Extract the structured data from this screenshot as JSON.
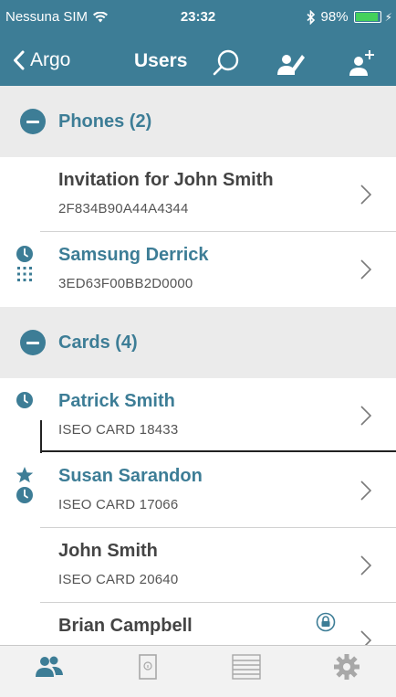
{
  "status_bar": {
    "carrier": "Nessuna SIM",
    "time": "23:32",
    "battery_percent": "98%",
    "battery_level": 0.98,
    "icons": [
      "wifi-icon",
      "bluetooth-icon",
      "battery-icon"
    ]
  },
  "nav": {
    "back_label": "Argo",
    "title": "Users",
    "icons": [
      "search-icon",
      "edit-user-icon",
      "add-user-icon"
    ]
  },
  "sections": [
    {
      "title": "Phones (2)",
      "rows": [
        {
          "name": "Invitation for John Smith",
          "sub": "2F834B90A44A4344"
        },
        {
          "name": "Samsung Derrick",
          "sub": "3ED63F00BB2D0000",
          "icons": [
            "clock-icon",
            "keypad-icon"
          ]
        }
      ]
    },
    {
      "title": "Cards (4)",
      "rows": [
        {
          "name": "Patrick Smith",
          "sub": "ISEO CARD 18433",
          "icons": [
            "clock-icon"
          ]
        },
        {
          "name": "Susan Sarandon",
          "sub": "ISEO CARD 17066",
          "icons": [
            "star-icon",
            "clock-icon"
          ]
        },
        {
          "name": "John Smith",
          "sub": "ISEO CARD 20640"
        },
        {
          "name": "Brian Campbell",
          "sub": "",
          "icons": [
            "lock-icon"
          ]
        }
      ]
    }
  ],
  "tab_bar": {
    "tabs": [
      {
        "icon": "users-icon",
        "label": ""
      },
      {
        "icon": "door-icon",
        "label": ""
      },
      {
        "icon": "list-icon",
        "label": ""
      },
      {
        "icon": "gear-icon",
        "label": ""
      }
    ],
    "active_color": "#3d7d96"
  },
  "colors": {
    "accent": "#3d7d96",
    "section_background": "#ebebeb",
    "text": "#444444"
  }
}
